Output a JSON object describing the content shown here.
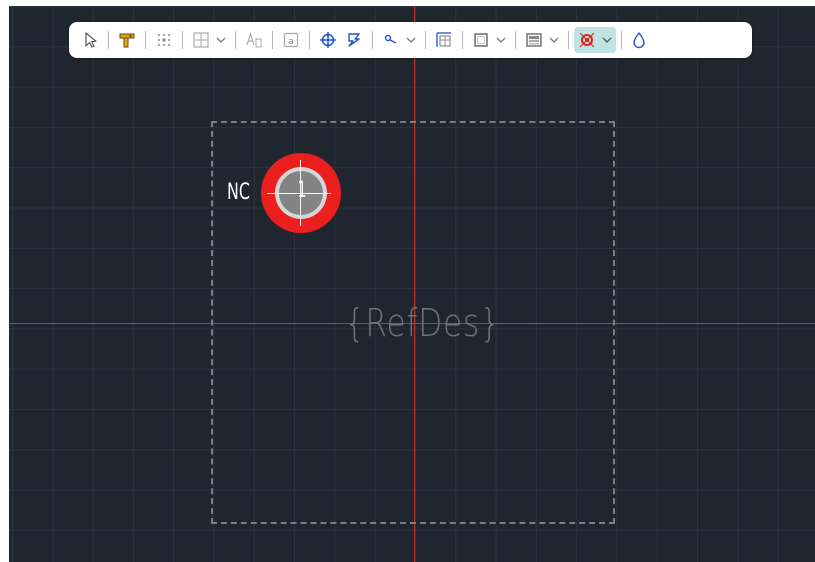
{
  "canvas": {
    "pin_name": "NC",
    "pad_number": "1",
    "refdes_placeholder": "{RefDes}"
  },
  "colors": {
    "canvas_bg": "#1f2630",
    "grid": "#2b3440",
    "axis": "#c2352f",
    "pad": "#ec1f1f",
    "outline": "#7b7f88",
    "toolbar_active": "#bfe3e2"
  },
  "toolbar": {
    "tools": [
      {
        "icon": "select-pointer-icon"
      },
      {
        "icon": "pin-tool-icon"
      },
      {
        "icon": "pin-array-icon"
      },
      {
        "icon": "grid-icon",
        "dropdown": true
      },
      {
        "icon": "text-icon"
      },
      {
        "icon": "attribute-icon"
      },
      {
        "icon": "origin-icon"
      },
      {
        "icon": "pad-stack-icon"
      },
      {
        "icon": "measure-icon",
        "dropdown": true
      },
      {
        "icon": "dimension-icon"
      },
      {
        "icon": "outline-icon",
        "dropdown": true
      },
      {
        "icon": "layer-icon",
        "dropdown": true
      },
      {
        "icon": "pad-toggle-icon",
        "dropdown": true,
        "active": true
      },
      {
        "icon": "drop-icon"
      }
    ]
  }
}
